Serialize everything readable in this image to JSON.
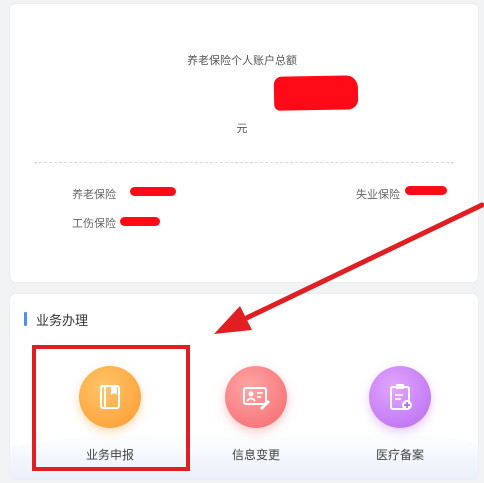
{
  "account": {
    "total_title": "养老保险个人账户总额",
    "total_unit": "元",
    "insurances": [
      {
        "label": "养老保险"
      },
      {
        "label": "失业保险"
      },
      {
        "label": "工伤保险"
      }
    ]
  },
  "services": {
    "section_title": "业务办理",
    "items": [
      {
        "label": "业务申报",
        "icon": "book-icon"
      },
      {
        "label": "信息变更",
        "icon": "id-card-edit-icon"
      },
      {
        "label": "医疗备案",
        "icon": "clipboard-plus-icon"
      }
    ]
  },
  "colors": {
    "redaction": "#ff0a16",
    "annotation": "#e11f22",
    "accent": "#4e8ef7"
  }
}
